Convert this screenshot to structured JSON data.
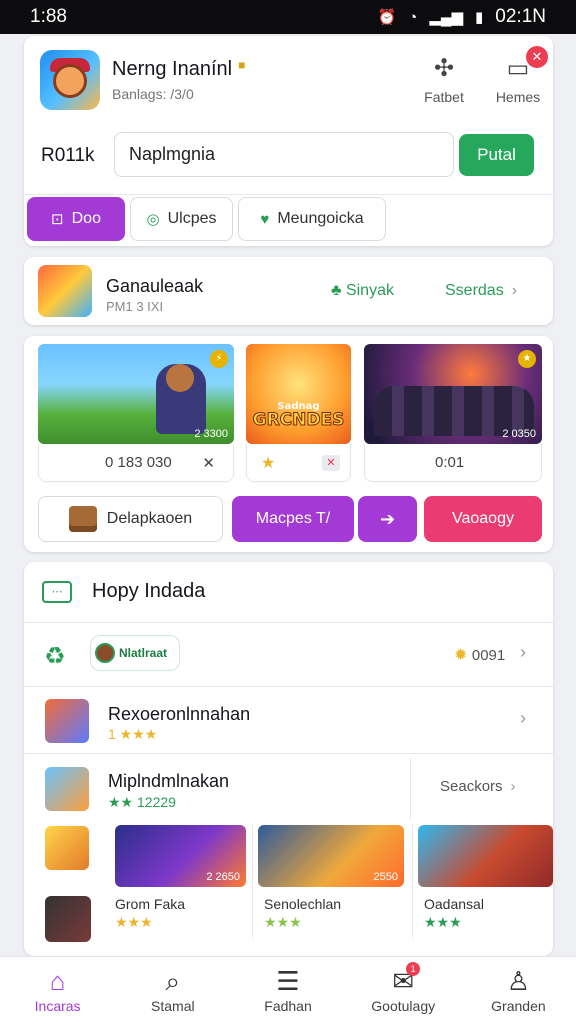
{
  "status_bar": {
    "time": "1:88",
    "clock": "02:1N"
  },
  "app": {
    "title": "Nerng Inanínl",
    "subtitle": "Banlags: /3/0",
    "actions": [
      {
        "label": "Fatbet",
        "icon": "puzzle-icon"
      },
      {
        "label": "Hemes",
        "icon": "message-icon",
        "badge": "x"
      }
    ],
    "price": "R011k",
    "search": {
      "value": "Naplmgnia",
      "placeholder": ""
    },
    "search_button": "Putal",
    "tabs": [
      {
        "label": "Doo",
        "icon": "bag-icon",
        "active": true
      },
      {
        "label": "Ulcpes",
        "icon": "location-icon",
        "active": false
      },
      {
        "label": "Meungoicka",
        "icon": "chat-heart-icon",
        "active": false
      }
    ]
  },
  "game_row": {
    "name": "Ganauleaak",
    "sub": "PM1 3 IXI",
    "link1": "Sinyak",
    "link2": "Sserdas"
  },
  "media": {
    "cards": [
      {
        "tag": "2 3300",
        "stat": "0 183 030"
      },
      {
        "art_title": "GRCNDES",
        "art_sub": "Sadnag"
      },
      {
        "tag": "2 0350",
        "stat": "0:01"
      }
    ],
    "actions": {
      "download": "Delapkaoen",
      "primary": "Macpes T/",
      "next": "➔",
      "secondary": "Vaoaogy"
    }
  },
  "list": {
    "title": "Hopy Indada",
    "pill": "Nlatlraat",
    "score": "0091",
    "rows": [
      {
        "title": "Rexoeronlnnahan",
        "rating": "1 ★★★"
      },
      {
        "title": "Miplndmlnakan",
        "rating": "★★ 12229",
        "link": "Seackors"
      }
    ],
    "tiles": [
      {
        "tag": "2 2650",
        "name": "Grom Faka",
        "rating": "★★★"
      },
      {
        "tag": "2550",
        "name": "Senolechlan",
        "rating": "★★★"
      },
      {
        "tag": "",
        "name": "Oadansal",
        "rating": "★★★"
      }
    ]
  },
  "bottom_nav": [
    {
      "label": "Incaras",
      "icon": "home-icon",
      "active": true
    },
    {
      "label": "Stamal",
      "icon": "search-icon",
      "active": false
    },
    {
      "label": "Fadhan",
      "icon": "document-icon",
      "active": false
    },
    {
      "label": "Gootulagy",
      "icon": "mail-icon",
      "active": false,
      "badge": "1"
    },
    {
      "label": "Granden",
      "icon": "profile-icon",
      "active": false
    }
  ],
  "colors": {
    "accent": "#a33ad6",
    "success": "#26a85c",
    "pink": "#ea3c73"
  }
}
